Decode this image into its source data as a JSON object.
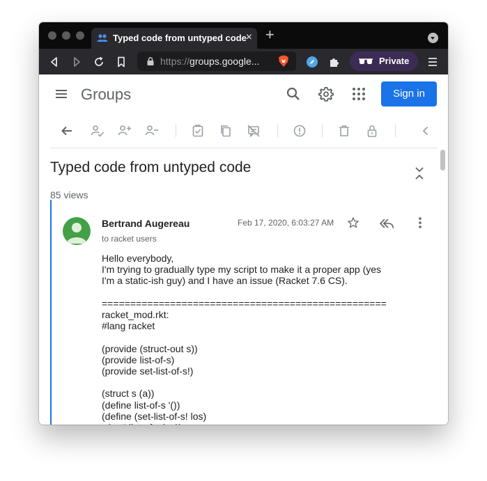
{
  "browser": {
    "tab_title": "Typed code from untyped code",
    "tab_close": "×",
    "new_tab": "+",
    "url_protocol": "https://",
    "url_host": "groups.google...",
    "private_label": "Private"
  },
  "groups": {
    "logo": "Groups",
    "signin_label": "Sign in"
  },
  "thread": {
    "title": "Typed code from untyped code",
    "views": "85 views"
  },
  "message": {
    "author": "Bertrand Augereau",
    "recipient": "to racket users",
    "date": "Feb 17, 2020, 6:03:27 AM",
    "lines": [
      "Hello everybody,",
      "I'm trying to gradually type my script to make it a proper app (yes",
      "I'm a static-ish guy) and I have an issue (Racket 7.6 CS).",
      "",
      "==================================================",
      "racket_mod.rkt:",
      "#lang racket",
      "",
      "(provide (struct-out s))",
      "(provide list-of-s)",
      "(provide set-list-of-s!)",
      "",
      "(struct s (a))",
      "(define list-of-s '())",
      "(define (set-list-of-s! los)",
      "  (set! list-of-s los))"
    ]
  },
  "colors": {
    "accent": "#1a73e8",
    "avatar": "#43a047",
    "private_bg": "#3c2c55"
  }
}
